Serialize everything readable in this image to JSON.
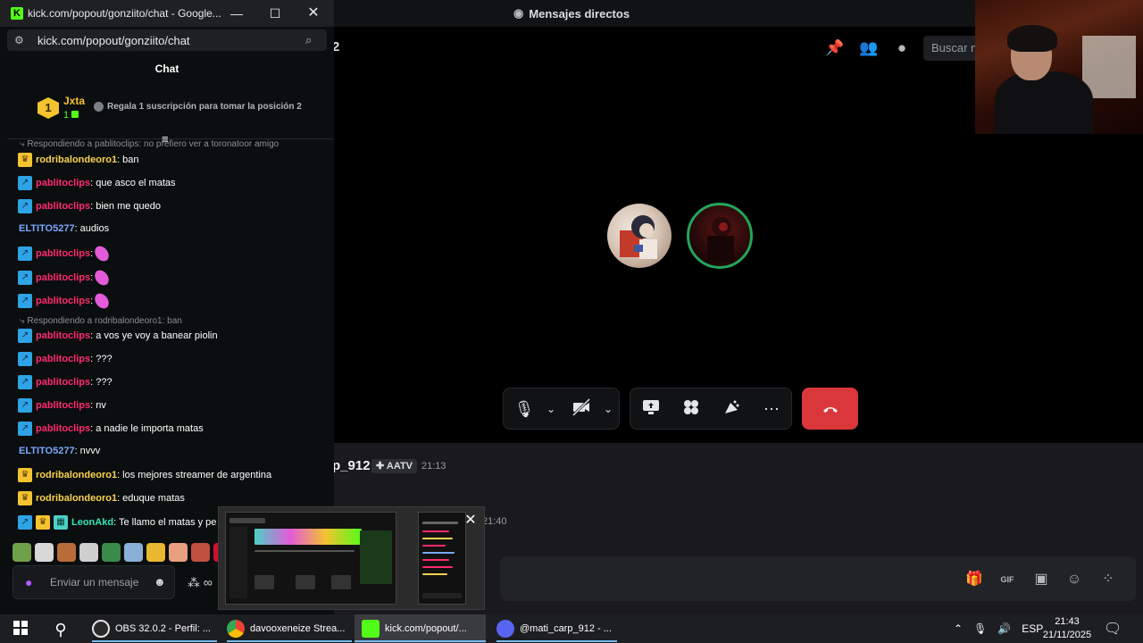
{
  "discord": {
    "window_title": "Mensajes directos",
    "channel_fragment": "2",
    "search_placeholder": "Buscar m",
    "message": {
      "author_fragment": "p_912",
      "tag": "AATV",
      "time": "21:13",
      "time2": "21:40"
    },
    "call_controls": [
      "mic-icon",
      "camera-off-icon",
      "screen-share-icon",
      "activities-icon",
      "soundboard-icon",
      "more-icon",
      "hangup-icon"
    ],
    "accent_colors": {
      "hangup": "#da373c",
      "speaking": "#23a55a"
    }
  },
  "kick": {
    "window_title": "kick.com/popout/gonziito/chat - Google...",
    "url": "kick.com/popout/gonziito/chat",
    "chat_title": "Chat",
    "top_gifter": {
      "rank": "1",
      "name": "Jxta",
      "count": "1"
    },
    "gift_message": "Regala 1 suscripción para tomar la posición 2",
    "messages": [
      {
        "type": "reply",
        "text": "Respondiendo a pablitoclips: no prefiero ver a toronatoor amigo"
      },
      {
        "badge": "crown",
        "user": "rodribalondeoro1",
        "color": "rodri",
        "text": ": ban"
      },
      {
        "badge": "sub",
        "user": "pablitoclips",
        "color": "pablito",
        "text": ": que asco el matas"
      },
      {
        "badge": "sub",
        "user": "pablitoclips",
        "color": "pablito",
        "text": ": bien me quedo"
      },
      {
        "badge": "",
        "user": "ELTITO5277",
        "color": "eltito",
        "text": ": audios"
      },
      {
        "badge": "sub",
        "user": "pablitoclips",
        "color": "pablito",
        "text": ":",
        "emote": true
      },
      {
        "badge": "sub",
        "user": "pablitoclips",
        "color": "pablito",
        "text": ":",
        "emote": true
      },
      {
        "badge": "sub",
        "user": "pablitoclips",
        "color": "pablito",
        "text": ":",
        "emote": true
      },
      {
        "type": "reply",
        "text": "Respondiendo a rodribalondeoro1: ban"
      },
      {
        "badge": "sub",
        "user": "pablitoclips",
        "color": "pablito",
        "text": ": a vos ye voy a banear piolin"
      },
      {
        "badge": "sub",
        "user": "pablitoclips",
        "color": "pablito",
        "text": ": ???"
      },
      {
        "badge": "sub",
        "user": "pablitoclips",
        "color": "pablito",
        "text": ": ???"
      },
      {
        "badge": "sub",
        "user": "pablitoclips",
        "color": "pablito",
        "text": ": nv"
      },
      {
        "badge": "sub",
        "user": "pablitoclips",
        "color": "pablito",
        "text": ": a nadie le importa matas"
      },
      {
        "badge": "",
        "user": "ELTITO5277",
        "color": "eltito",
        "text": ": nvvv"
      },
      {
        "badge": "crown",
        "user": "rodribalondeoro1",
        "color": "rodri",
        "text": ": los mejores streamer de argentina"
      },
      {
        "badge": "crown",
        "user": "rodribalondeoro1",
        "color": "rodri",
        "text": ": eduque matas"
      },
      {
        "badge": "multi",
        "user": "LeonAkd",
        "color": "leon",
        "text": ": Te llamo el matas y pe"
      }
    ],
    "input_placeholder": "Enviar un mensaje"
  },
  "taskbar": {
    "apps": [
      {
        "label": "OBS 32.0.2 - Perfil: ...",
        "color": "#e6e6e6"
      },
      {
        "label": "davooxeneize Strea...",
        "color": "#4285f4"
      },
      {
        "label": "kick.com/popout/...",
        "color": "#53fc18"
      },
      {
        "label": "@mati_carp_912 - ...",
        "color": "#5865f2"
      }
    ],
    "language": "ESP",
    "time": "21:43",
    "date": "21/11/2025"
  }
}
